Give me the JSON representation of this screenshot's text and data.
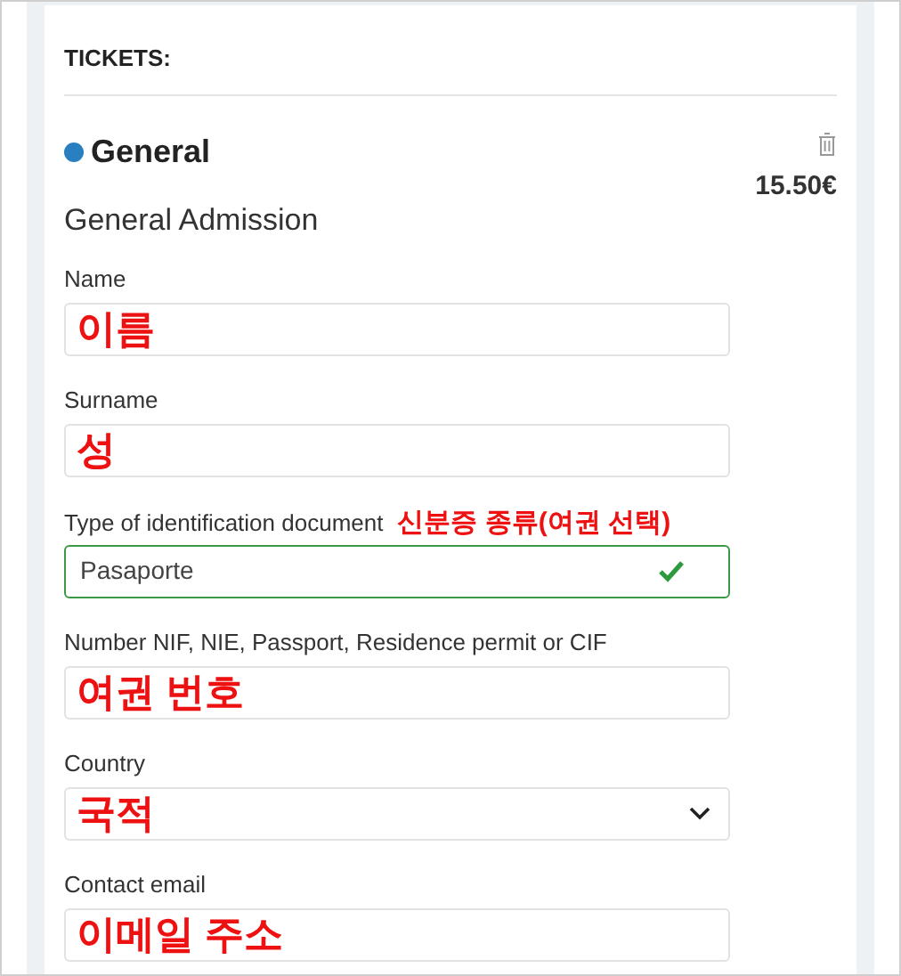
{
  "section_title": "TICKETS:",
  "ticket": {
    "name": "General",
    "color": "#2a7fc0",
    "description": "General Admission",
    "price": "15.50€"
  },
  "fields": [
    {
      "kind": "text",
      "label": "Name",
      "value": "이름",
      "annotated": true
    },
    {
      "kind": "text",
      "label": "Surname",
      "value": "성",
      "annotated": true
    },
    {
      "kind": "select",
      "label": "Type of identification document",
      "note": "신분증 종류(여권 선택)",
      "value": "Pasaporte",
      "valid": true,
      "annotated": false
    },
    {
      "kind": "text",
      "label": "Number NIF, NIE, Passport, Residence permit or CIF",
      "value": "여권 번호",
      "annotated": true
    },
    {
      "kind": "select",
      "label": "Country",
      "value": "국적",
      "valid": false,
      "annotated": true
    },
    {
      "kind": "text",
      "label": "Contact email",
      "value": "이메일 주소",
      "annotated": true
    }
  ]
}
